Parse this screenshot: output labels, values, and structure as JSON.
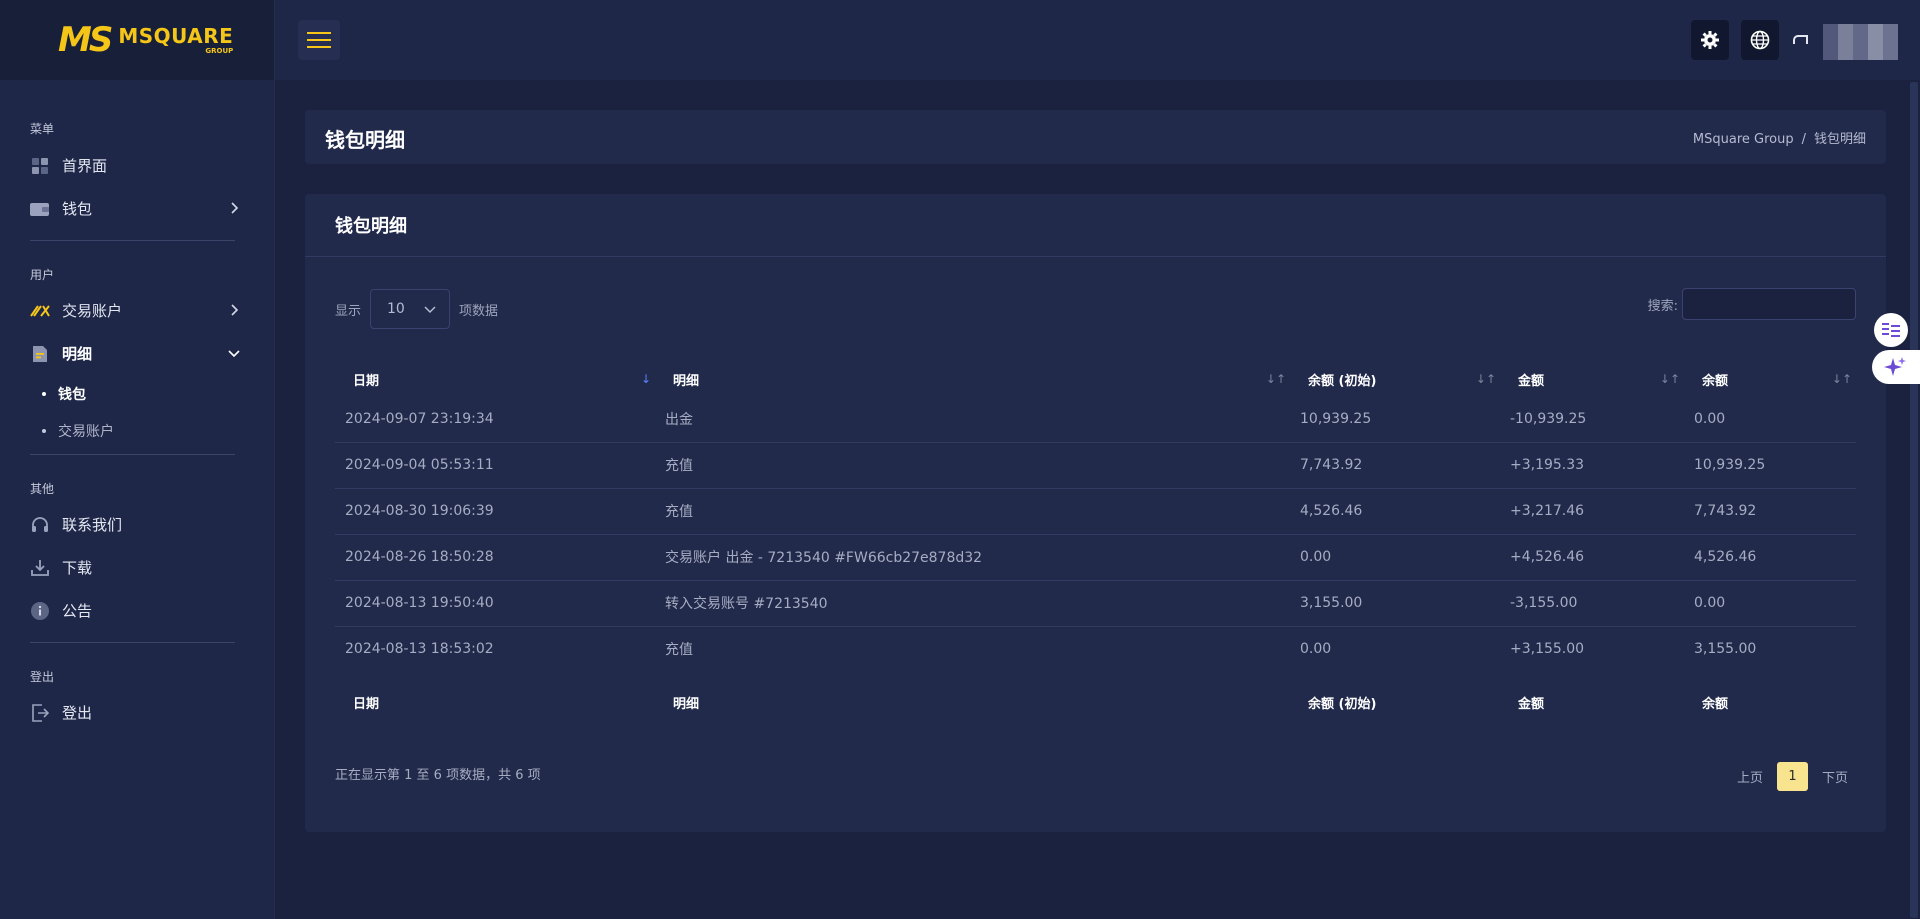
{
  "brand": {
    "mark": "MS",
    "name": "MSQUARE",
    "sub": "GROUP",
    "color": "#f5c518"
  },
  "sidebar": {
    "sections": [
      {
        "label": "菜单",
        "items": [
          {
            "label": "首界面",
            "icon": "dashboard-icon"
          },
          {
            "label": "钱包",
            "icon": "wallet-icon",
            "chevron": "right"
          }
        ]
      },
      {
        "label": "用户",
        "items": [
          {
            "label": "交易账户",
            "icon": "trading-icon",
            "chevron": "right"
          },
          {
            "label": "明细",
            "icon": "document-icon",
            "chevron": "down",
            "active": true,
            "children": [
              {
                "label": "钱包",
                "active": true
              },
              {
                "label": "交易账户"
              }
            ]
          }
        ]
      },
      {
        "label": "其他",
        "items": [
          {
            "label": "联系我们",
            "icon": "headset-icon"
          },
          {
            "label": "下载",
            "icon": "download-icon"
          },
          {
            "label": "公告",
            "icon": "info-icon"
          }
        ]
      },
      {
        "label": "登出",
        "items": [
          {
            "label": "登出",
            "icon": "logout-icon"
          }
        ]
      }
    ]
  },
  "header": {
    "icons": [
      "menu-icon",
      "settings-icon",
      "globe-icon"
    ]
  },
  "page": {
    "title": "钱包明细",
    "breadcrumb": [
      "MSquare Group",
      "/",
      "钱包明细"
    ]
  },
  "card": {
    "title": "钱包明细",
    "length": {
      "prefix": "显示",
      "value": "10",
      "suffix": "项数据"
    },
    "search": {
      "label": "搜索:",
      "value": ""
    },
    "columns": [
      "日期",
      "明细",
      "余额 (初始)",
      "金额",
      "余额"
    ],
    "rows": [
      [
        "2024-09-07 23:19:34",
        "出金",
        "10,939.25",
        "-10,939.25",
        "0.00"
      ],
      [
        "2024-09-04 05:53:11",
        "充值",
        "7,743.92",
        "+3,195.33",
        "10,939.25"
      ],
      [
        "2024-08-30 19:06:39",
        "充值",
        "4,526.46",
        "+3,217.46",
        "7,743.92"
      ],
      [
        "2024-08-26 18:50:28",
        "交易账户 出金 - 7213540 #FW66cb27e878d32",
        "0.00",
        "+4,526.46",
        "4,526.46"
      ],
      [
        "2024-08-13 19:50:40",
        "转入交易账号 #7213540",
        "3,155.00",
        "-3,155.00",
        "0.00"
      ],
      [
        "2024-08-13 18:53:02",
        "充值",
        "0.00",
        "+3,155.00",
        "3,155.00"
      ]
    ],
    "info": "正在显示第 1 至 6 项数据，共 6 项",
    "pager": {
      "prev": "上页",
      "current": "1",
      "next": "下页"
    }
  }
}
